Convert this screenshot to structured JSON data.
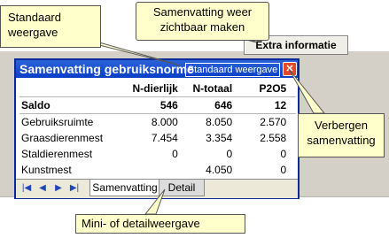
{
  "callouts": {
    "standard_view": "Standaard weergave",
    "show_summary_again": "Samenvatting weer zichtbaar maken",
    "hide_summary": "Verbergen samenvatting",
    "mini_or_detail": "Mini- of detailweergave"
  },
  "extra_button_label": "Extra informatie",
  "window": {
    "title": "Samenvatting gebruiksnorme",
    "standard_view_button": "Standaard weergave",
    "close_symbol": "✕"
  },
  "table": {
    "headers": [
      "",
      "N-dierlijk",
      "N-totaal",
      "P2O5"
    ],
    "rows": [
      {
        "name": "Saldo",
        "values": [
          "546",
          "646",
          "12"
        ]
      },
      {
        "name": "Gebruiksruimte",
        "values": [
          "8.000",
          "8.050",
          "2.570"
        ]
      },
      {
        "name": "Graasdierenmest",
        "values": [
          "7.454",
          "3.354",
          "2.558"
        ]
      },
      {
        "name": "Staldierenmest",
        "values": [
          "0",
          "0",
          "0"
        ]
      },
      {
        "name": "Kunstmest",
        "values": [
          "",
          "4.050",
          "0"
        ]
      }
    ]
  },
  "tabs": {
    "summary": "Samenvatting",
    "detail": "Detail"
  },
  "nav_icons": [
    "first-record-icon",
    "previous-record-icon",
    "next-record-icon",
    "last-record-icon"
  ]
}
